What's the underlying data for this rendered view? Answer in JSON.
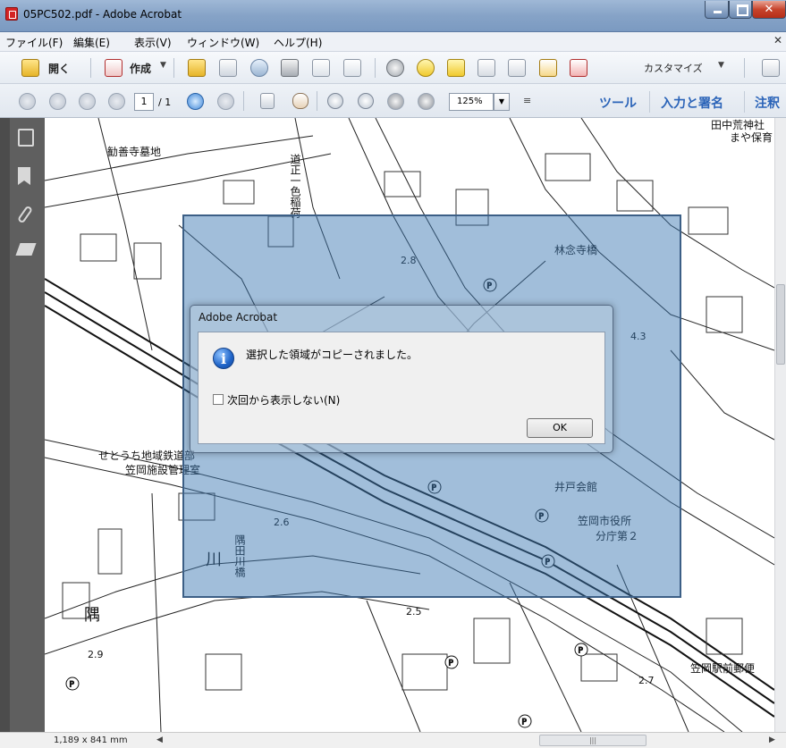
{
  "window": {
    "title": "05PC502.pdf - Adobe Acrobat"
  },
  "menu": [
    "ファイル(F)",
    "編集(E)",
    "表示(V)",
    "ウィンドウ(W)",
    "ヘルプ(H)"
  ],
  "toolbar": {
    "open_label": "開く",
    "create_label": "作成",
    "customize_label": "カスタマイズ"
  },
  "nav": {
    "page_current": "1",
    "page_total": "/ 1",
    "zoom": "125%",
    "tools_label": "ツール",
    "sign_label": "入力と署名",
    "comment_label": "注釈"
  },
  "map_labels": [
    "勧善寺墓地",
    "田中荒神社",
    "まや保育",
    "林念寺橋",
    "道正一色稲荷",
    "せとうち地域鉄道部",
    "笠岡施設管理室",
    "井戸会館",
    "笠岡市役所",
    "分庁第２",
    "隅田川橋",
    "笠岡駅前郵便",
    "2.8",
    "4.3",
    "2.6",
    "2.5",
    "2.9",
    "2.7",
    "隅",
    "川"
  ],
  "dialog": {
    "title": "Adobe Acrobat",
    "message": "選択した領域がコピーされました。",
    "checkbox_label": "次回から表示しない(N)",
    "ok_label": "OK"
  },
  "status": {
    "page_size": "1,189 x 841 mm"
  },
  "colors": {
    "selection": "#3a78b2",
    "title_bar": "#86a3c7",
    "link_blue": "#2a63b8"
  }
}
